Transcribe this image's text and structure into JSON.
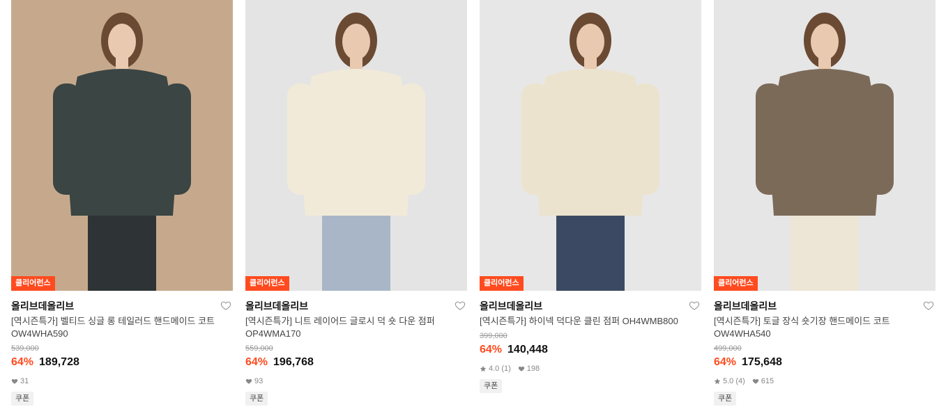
{
  "products": [
    {
      "badge": "클리어런스",
      "brand": "올리브데올리브",
      "title_line1": "[역시즌특가] 벨티드 싱글 롱 테일러드 핸드메이드 코트",
      "title_line2": "OW4WHA590",
      "original_price": "539,000",
      "discount": "64%",
      "price": "189,728",
      "rating": "",
      "likes": "31",
      "coupon": "쿠폰",
      "colors": {
        "bg": "#c6a98c",
        "garment": "#3a4544",
        "pants": "#2e3335"
      }
    },
    {
      "badge": "클리어런스",
      "brand": "올리브데올리브",
      "title_line1": "[역시즌특가] 니트 레이어드 글로시 덕 숏 다운 점퍼",
      "title_line2": "OP4WMA170",
      "original_price": "559,000",
      "discount": "64%",
      "price": "196,768",
      "rating": "",
      "likes": "93",
      "coupon": "쿠폰",
      "colors": {
        "bg": "#e4e4e4",
        "garment": "#f2ead8",
        "pants": "#a9b6c8"
      }
    },
    {
      "badge": "클리어런스",
      "brand": "올리브데올리브",
      "title_line1": "[역시즌특가] 하이넥 덕다운 클린 점퍼 OH4WMB800",
      "title_line2": "",
      "original_price": "399,000",
      "discount": "64%",
      "price": "140,448",
      "rating": "4.0 (1)",
      "likes": "198",
      "coupon": "쿠폰",
      "colors": {
        "bg": "#e7e7e7",
        "garment": "#ece3cf",
        "pants": "#3b4a62"
      }
    },
    {
      "badge": "클리어런스",
      "brand": "올리브데올리브",
      "title_line1": "[역시즌특가] 토글 장식 숏기장 핸드메이드 코트",
      "title_line2": "OW4WHA540",
      "original_price": "499,000",
      "discount": "64%",
      "price": "175,648",
      "rating": "5.0 (4)",
      "likes": "615",
      "coupon": "쿠폰",
      "colors": {
        "bg": "#e6e6e6",
        "garment": "#7c6a59",
        "pants": "#ede6d6"
      }
    }
  ]
}
